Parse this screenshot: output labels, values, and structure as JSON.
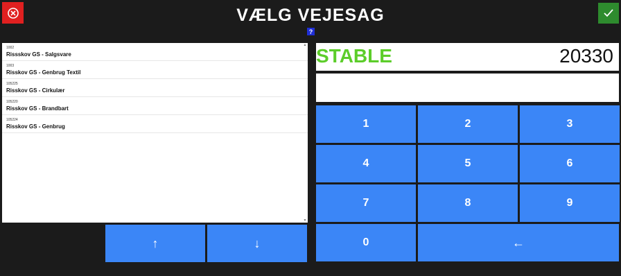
{
  "header": {
    "title": "VÆLG VEJESAG",
    "help_label": "?"
  },
  "list": {
    "items": [
      {
        "code": "1002",
        "name": "Rissskov GS - Salgsvare"
      },
      {
        "code": "1003",
        "name": "Risskov GS - Genbrug Textil"
      },
      {
        "code": "105225",
        "name": "Risskov GS - Cirkulær"
      },
      {
        "code": "105220",
        "name": "Risskov GS - Brandbart"
      },
      {
        "code": "105224",
        "name": "Risskov GS - Genbrug"
      }
    ]
  },
  "display": {
    "status": "STABLE",
    "weight": "20330",
    "input_value": ""
  },
  "keypad": {
    "keys": [
      "1",
      "2",
      "3",
      "4",
      "5",
      "6",
      "7",
      "8",
      "9",
      "0"
    ],
    "backspace": "←"
  },
  "nav": {
    "up": "↑",
    "down": "↓"
  },
  "colors": {
    "background": "#1b1b1b",
    "button_blue": "#3b86f7",
    "cancel_red": "#e02020",
    "ok_green": "#2e8b2e",
    "stable_green": "#5ccd2a"
  },
  "icons": {
    "cancel": "close-circle-icon",
    "ok": "checkmark-icon"
  }
}
